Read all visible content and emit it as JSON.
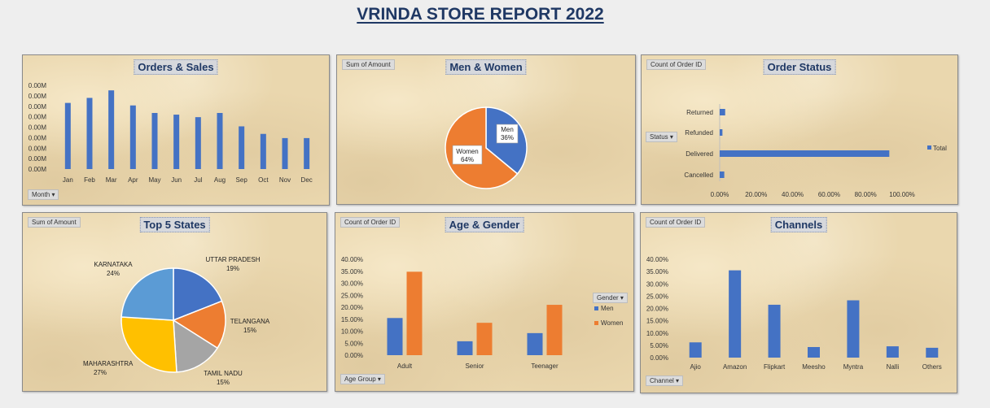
{
  "report_title": "VRINDA STORE REPORT 2022",
  "colors": {
    "blue": "#4472c4",
    "orange": "#ed7d31",
    "grey": "#a5a5a5",
    "yellow": "#ffc000",
    "lightblue": "#5b9bd5",
    "title": "#1f3864"
  },
  "panels": {
    "orders_sales": {
      "title": "Orders & Sales",
      "filter": "Month"
    },
    "men_women": {
      "title": "Men & Women",
      "field": "Sum of Amount"
    },
    "order_status": {
      "title": "Order Status",
      "field": "Count of Order ID",
      "filter": "Status",
      "legend": "Total"
    },
    "top_states": {
      "title": "Top 5 States",
      "field": "Sum of Amount"
    },
    "age_gender": {
      "title": "Age & Gender",
      "field": "Count of Order ID",
      "filter": "Age Group",
      "legend_title": "Gender"
    },
    "channels": {
      "title": "Channels",
      "field": "Count of Order ID",
      "filter": "Channel"
    }
  },
  "chart_data": [
    {
      "id": "orders_sales",
      "type": "bar",
      "title": "Orders & Sales",
      "categories": [
        "Jan",
        "Feb",
        "Mar",
        "Apr",
        "May",
        "Jun",
        "Jul",
        "Aug",
        "Sep",
        "Oct",
        "Nov",
        "Dec"
      ],
      "values": [
        0.79,
        0.85,
        0.94,
        0.76,
        0.67,
        0.65,
        0.62,
        0.67,
        0.51,
        0.42,
        0.37,
        0.37
      ],
      "y_tick_labels": [
        "0.00M",
        "0.00M",
        "0.00M",
        "0.00M",
        "0.00M",
        "0.00M",
        "0.00M",
        "0.00M",
        "0.00M"
      ],
      "ylim": [
        0,
        1
      ]
    },
    {
      "id": "men_women",
      "type": "pie",
      "title": "Men & Women",
      "labels": [
        "Men",
        "Women"
      ],
      "values": [
        36,
        64
      ],
      "data_labels": [
        "36%",
        "64%"
      ]
    },
    {
      "id": "order_status",
      "type": "bar",
      "orientation": "horizontal",
      "title": "Order Status",
      "categories": [
        "Returned",
        "Refunded",
        "Delivered",
        "Cancelled"
      ],
      "series": [
        {
          "name": "Total",
          "values": [
            3,
            1.5,
            93,
            2.5
          ]
        }
      ],
      "x_tick_labels": [
        "0.00%",
        "20.00%",
        "40.00%",
        "60.00%",
        "80.00%",
        "100.00%"
      ],
      "xlim": [
        0,
        100
      ]
    },
    {
      "id": "top_states",
      "type": "pie",
      "title": "Top 5 States",
      "labels": [
        "UTTAR PRADESH",
        "TELANGANA",
        "TAMIL NADU",
        "MAHARASHTRA",
        "KARNATAKA"
      ],
      "values": [
        19,
        15,
        15,
        27,
        24
      ],
      "data_labels": [
        "19%",
        "15%",
        "15%",
        "27%",
        "24%"
      ]
    },
    {
      "id": "age_gender",
      "type": "bar",
      "title": "Age & Gender",
      "categories": [
        "Adult",
        "Senior",
        "Teenager"
      ],
      "series": [
        {
          "name": "Men",
          "values": [
            15.5,
            5.8,
            9.2
          ]
        },
        {
          "name": "Women",
          "values": [
            34.8,
            13.5,
            21.0
          ]
        }
      ],
      "y_tick_labels": [
        "0.00%",
        "5.00%",
        "10.00%",
        "15.00%",
        "20.00%",
        "25.00%",
        "30.00%",
        "35.00%",
        "40.00%"
      ],
      "ylim": [
        0,
        40
      ]
    },
    {
      "id": "channels",
      "type": "bar",
      "title": "Channels",
      "categories": [
        "Ajio",
        "Amazon",
        "Flipkart",
        "Meesho",
        "Myntra",
        "Nalli",
        "Others"
      ],
      "values": [
        6.2,
        35.5,
        21.5,
        4.3,
        23.3,
        4.6,
        4.0
      ],
      "y_tick_labels": [
        "0.00%",
        "5.00%",
        "10.00%",
        "15.00%",
        "20.00%",
        "25.00%",
        "30.00%",
        "35.00%",
        "40.00%"
      ],
      "ylim": [
        0,
        40
      ]
    }
  ]
}
